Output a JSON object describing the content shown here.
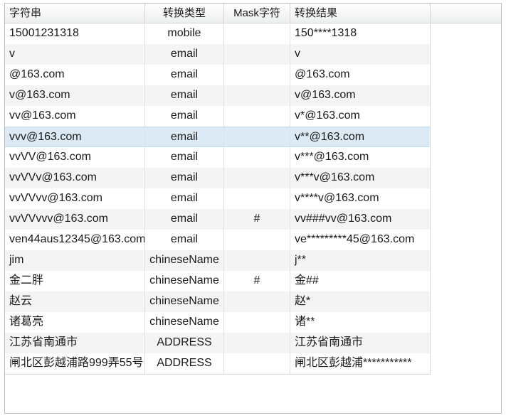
{
  "columns": [
    "字符串",
    "转换类型",
    "Mask字符",
    "转换结果"
  ],
  "selected_row": 5,
  "rows": [
    [
      "15001231318",
      "mobile",
      "",
      "150****1318"
    ],
    [
      "v",
      "email",
      "",
      "v"
    ],
    [
      "@163.com",
      "email",
      "",
      "@163.com"
    ],
    [
      "v@163.com",
      "email",
      "",
      "v@163.com"
    ],
    [
      "vv@163.com",
      "email",
      "",
      "v*@163.com"
    ],
    [
      "vvv@163.com",
      "email",
      "",
      "v**@163.com"
    ],
    [
      "vvVV@163.com",
      "email",
      "",
      "v***@163.com"
    ],
    [
      "vvVVv@163.com",
      "email",
      "",
      "v***v@163.com"
    ],
    [
      "vvVVvv@163.com",
      "email",
      "",
      "v****v@163.com"
    ],
    [
      "vvVVvvv@163.com",
      "email",
      "#",
      "vv###vv@163.com"
    ],
    [
      "ven44aus12345@163.com",
      "email",
      "",
      "ve*********45@163.com"
    ],
    [
      "jim",
      "chineseName",
      "",
      "j**"
    ],
    [
      "金二胖",
      "chineseName",
      "#",
      "金##"
    ],
    [
      "赵云",
      "chineseName",
      "",
      "赵*"
    ],
    [
      "诸葛亮",
      "chineseName",
      "",
      "诸**"
    ],
    [
      "江苏省南通市",
      "ADDRESS",
      "",
      "江苏省南通市"
    ],
    [
      "闸北区彭越浦路999弄55号",
      "ADDRESS",
      "",
      "闸北区彭越浦***********"
    ]
  ]
}
